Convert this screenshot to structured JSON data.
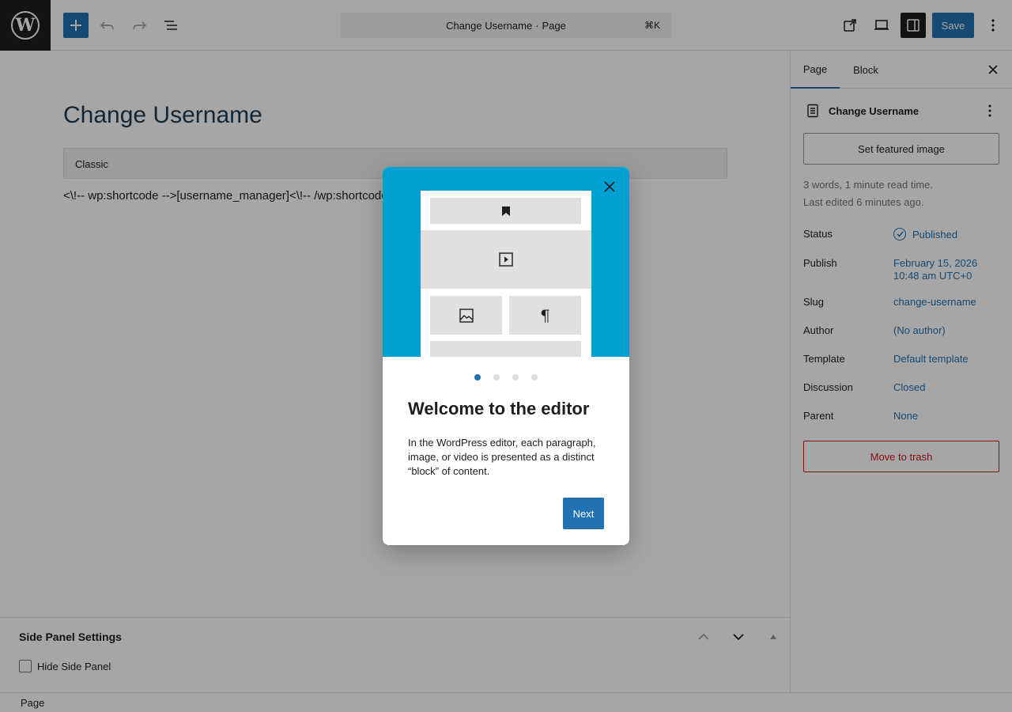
{
  "topbar": {
    "logo_letter": "W",
    "command_title": "Change Username",
    "command_separator": "·",
    "command_type": "Page",
    "command_shortcut": "⌘K",
    "save_label": "Save",
    "add_icon": "plus-icon",
    "undo_icon": "undo-icon",
    "redo_icon": "redo-icon",
    "list_view_icon": "list-view-icon",
    "view_icon": "external-link-icon",
    "preview_icon": "desktop-preview-icon",
    "settings_icon": "sidebar-settings-icon",
    "more_icon": "vertical-ellipsis-icon"
  },
  "editor": {
    "title": "Change Username",
    "classic_label": "Classic",
    "content": "<\\!-- wp:shortcode -->[username_manager]<\\!-- /wp:shortcode -->"
  },
  "metabox": {
    "title": "Side Panel Settings",
    "checkbox_label": "Hide Side Panel",
    "checked": false
  },
  "footer": {
    "breadcrumb": "Page"
  },
  "sidebar": {
    "tabs": [
      {
        "label": "Page",
        "active": true
      },
      {
        "label": "Block",
        "active": false
      }
    ],
    "doc_title": "Change Username",
    "featured_image_label": "Set featured image",
    "word_count": "3 words, 1 minute read time.",
    "last_edited": "Last edited 6 minutes ago.",
    "rows": [
      {
        "label": "Status",
        "value": "Published"
      },
      {
        "label": "Publish",
        "value": "February 15, 2026",
        "value2": "10:48 am UTC+0"
      },
      {
        "label": "Slug",
        "value": "change-username"
      },
      {
        "label": "Author",
        "value": "(No author)"
      },
      {
        "label": "Template",
        "value": "Default template"
      },
      {
        "label": "Discussion",
        "value": "Closed"
      },
      {
        "label": "Parent",
        "value": "None"
      }
    ],
    "trash_label": "Move to trash"
  },
  "modal": {
    "heading": "Welcome to the editor",
    "body": "In the WordPress editor, each paragraph, image, or video is presented as a distinct “block” of content.",
    "next_label": "Next",
    "pilcrow": "¶",
    "page_count": 4,
    "current_page": 1,
    "hero_color": "#00a0d2"
  },
  "colors": {
    "accent": "#2271b1",
    "danger": "#cc1818",
    "title": "#1d3b53"
  }
}
